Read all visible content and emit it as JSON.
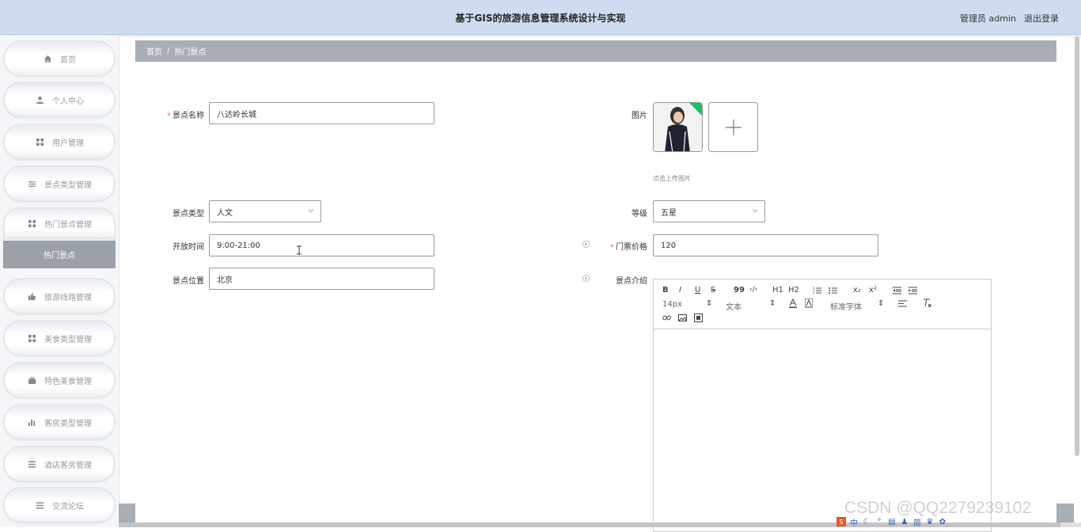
{
  "header": {
    "title": "基于GIS的旅游信息管理系统设计与实现",
    "user": "管理员 admin",
    "logout": "退出登录"
  },
  "sidebar": {
    "items": [
      {
        "label": "首页",
        "icon": "home-icon"
      },
      {
        "label": "个人中心",
        "icon": "user-icon"
      },
      {
        "label": "用户管理",
        "icon": "grid-icon"
      },
      {
        "label": "景点类型管理",
        "icon": "sliders-icon"
      },
      {
        "label": "热门景点管理",
        "icon": "grid-icon"
      },
      {
        "label": "旅游线路管理",
        "icon": "thumbs-up-icon"
      },
      {
        "label": "美食类型管理",
        "icon": "grid-icon"
      },
      {
        "label": "特色美食管理",
        "icon": "briefcase-icon"
      },
      {
        "label": "客房类型管理",
        "icon": "bar-chart-icon"
      },
      {
        "label": "酒店客房管理",
        "icon": "list-icon"
      },
      {
        "label": "交流论坛",
        "icon": "list-icon"
      }
    ],
    "active_sub": "热门景点"
  },
  "breadcrumb": {
    "home": "首页",
    "sep": "/",
    "current": "热门景点"
  },
  "form": {
    "name_label": "景点名称",
    "name_value": "八达岭长城",
    "image_label": "图片",
    "upload_hint": "点击上传图片",
    "type_label": "景点类型",
    "type_value": "人文",
    "level_label": "等级",
    "level_value": "五星",
    "open_label": "开放时间",
    "open_value": "9:00-21:00",
    "price_label": "门票价格",
    "price_value": "120",
    "location_label": "景点位置",
    "location_value": "北京",
    "intro_label": "景点介绍"
  },
  "editor": {
    "bold": "B",
    "italic": "I",
    "underline": "U",
    "strike": "S",
    "quote": "99",
    "code": "‹/›",
    "h1": "H1",
    "h2": "H2",
    "sub": "x₂",
    "sup": "x²",
    "size": "14px",
    "format": "文本",
    "font": "标准字体"
  },
  "watermark": "CSDN @QQ2279239102"
}
